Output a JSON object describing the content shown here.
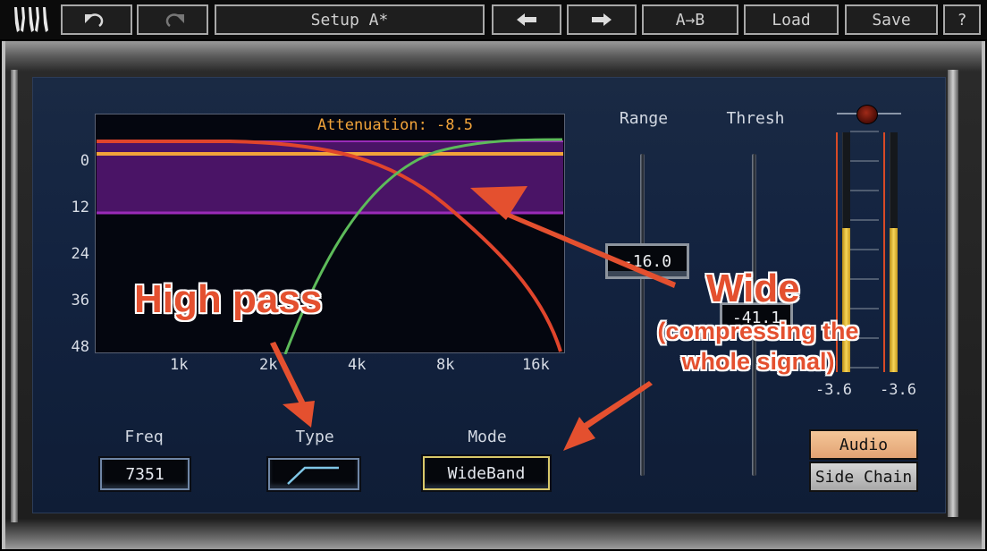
{
  "toolbar": {
    "logo": "waves-logo",
    "undo_icon": "undo-icon",
    "redo_icon": "redo-icon",
    "setup_label": "Setup A*",
    "prev_icon": "arrow-left-icon",
    "next_icon": "arrow-right-icon",
    "ab_label": "A→B",
    "load_label": "Load",
    "save_label": "Save",
    "help_label": "?"
  },
  "graph": {
    "attenuation_label": "Attenuation: -8.5",
    "y_ticks": [
      "0",
      "12",
      "24",
      "36",
      "48"
    ],
    "x_ticks": [
      "1k",
      "2k",
      "4k",
      "8k",
      "16k"
    ],
    "colors": {
      "band_fill": "#4a1466",
      "band_edge": "#9a2bb8",
      "threshold_line": "#f2a43a",
      "sidechain_curve": "#e0452c",
      "filter_curve": "#5dbb5a",
      "attenuation_text": "#f2a43a"
    }
  },
  "controls": {
    "range": {
      "label": "Range",
      "value": "-16.0"
    },
    "thresh": {
      "label": "Thresh",
      "value": "-41.1"
    },
    "freq": {
      "label": "Freq",
      "value": "7351"
    },
    "type": {
      "label": "Type",
      "icon": "high-pass-shape-icon"
    },
    "mode": {
      "label": "Mode",
      "value": "WideBand"
    }
  },
  "meters": {
    "left_value": "-3.6",
    "right_value": "-3.6",
    "left_level_fraction": 0.6,
    "right_level_fraction": 0.6,
    "clip_indicator": "clip-led-icon"
  },
  "source": {
    "audio_label": "Audio",
    "sidechain_label": "Side Chain",
    "selected": "Audio"
  },
  "annotations": {
    "high_pass": "High pass",
    "wide": "Wide",
    "wide_sub1": "(compressing the",
    "wide_sub2": "whole signal)",
    "color": "#e4502f"
  }
}
